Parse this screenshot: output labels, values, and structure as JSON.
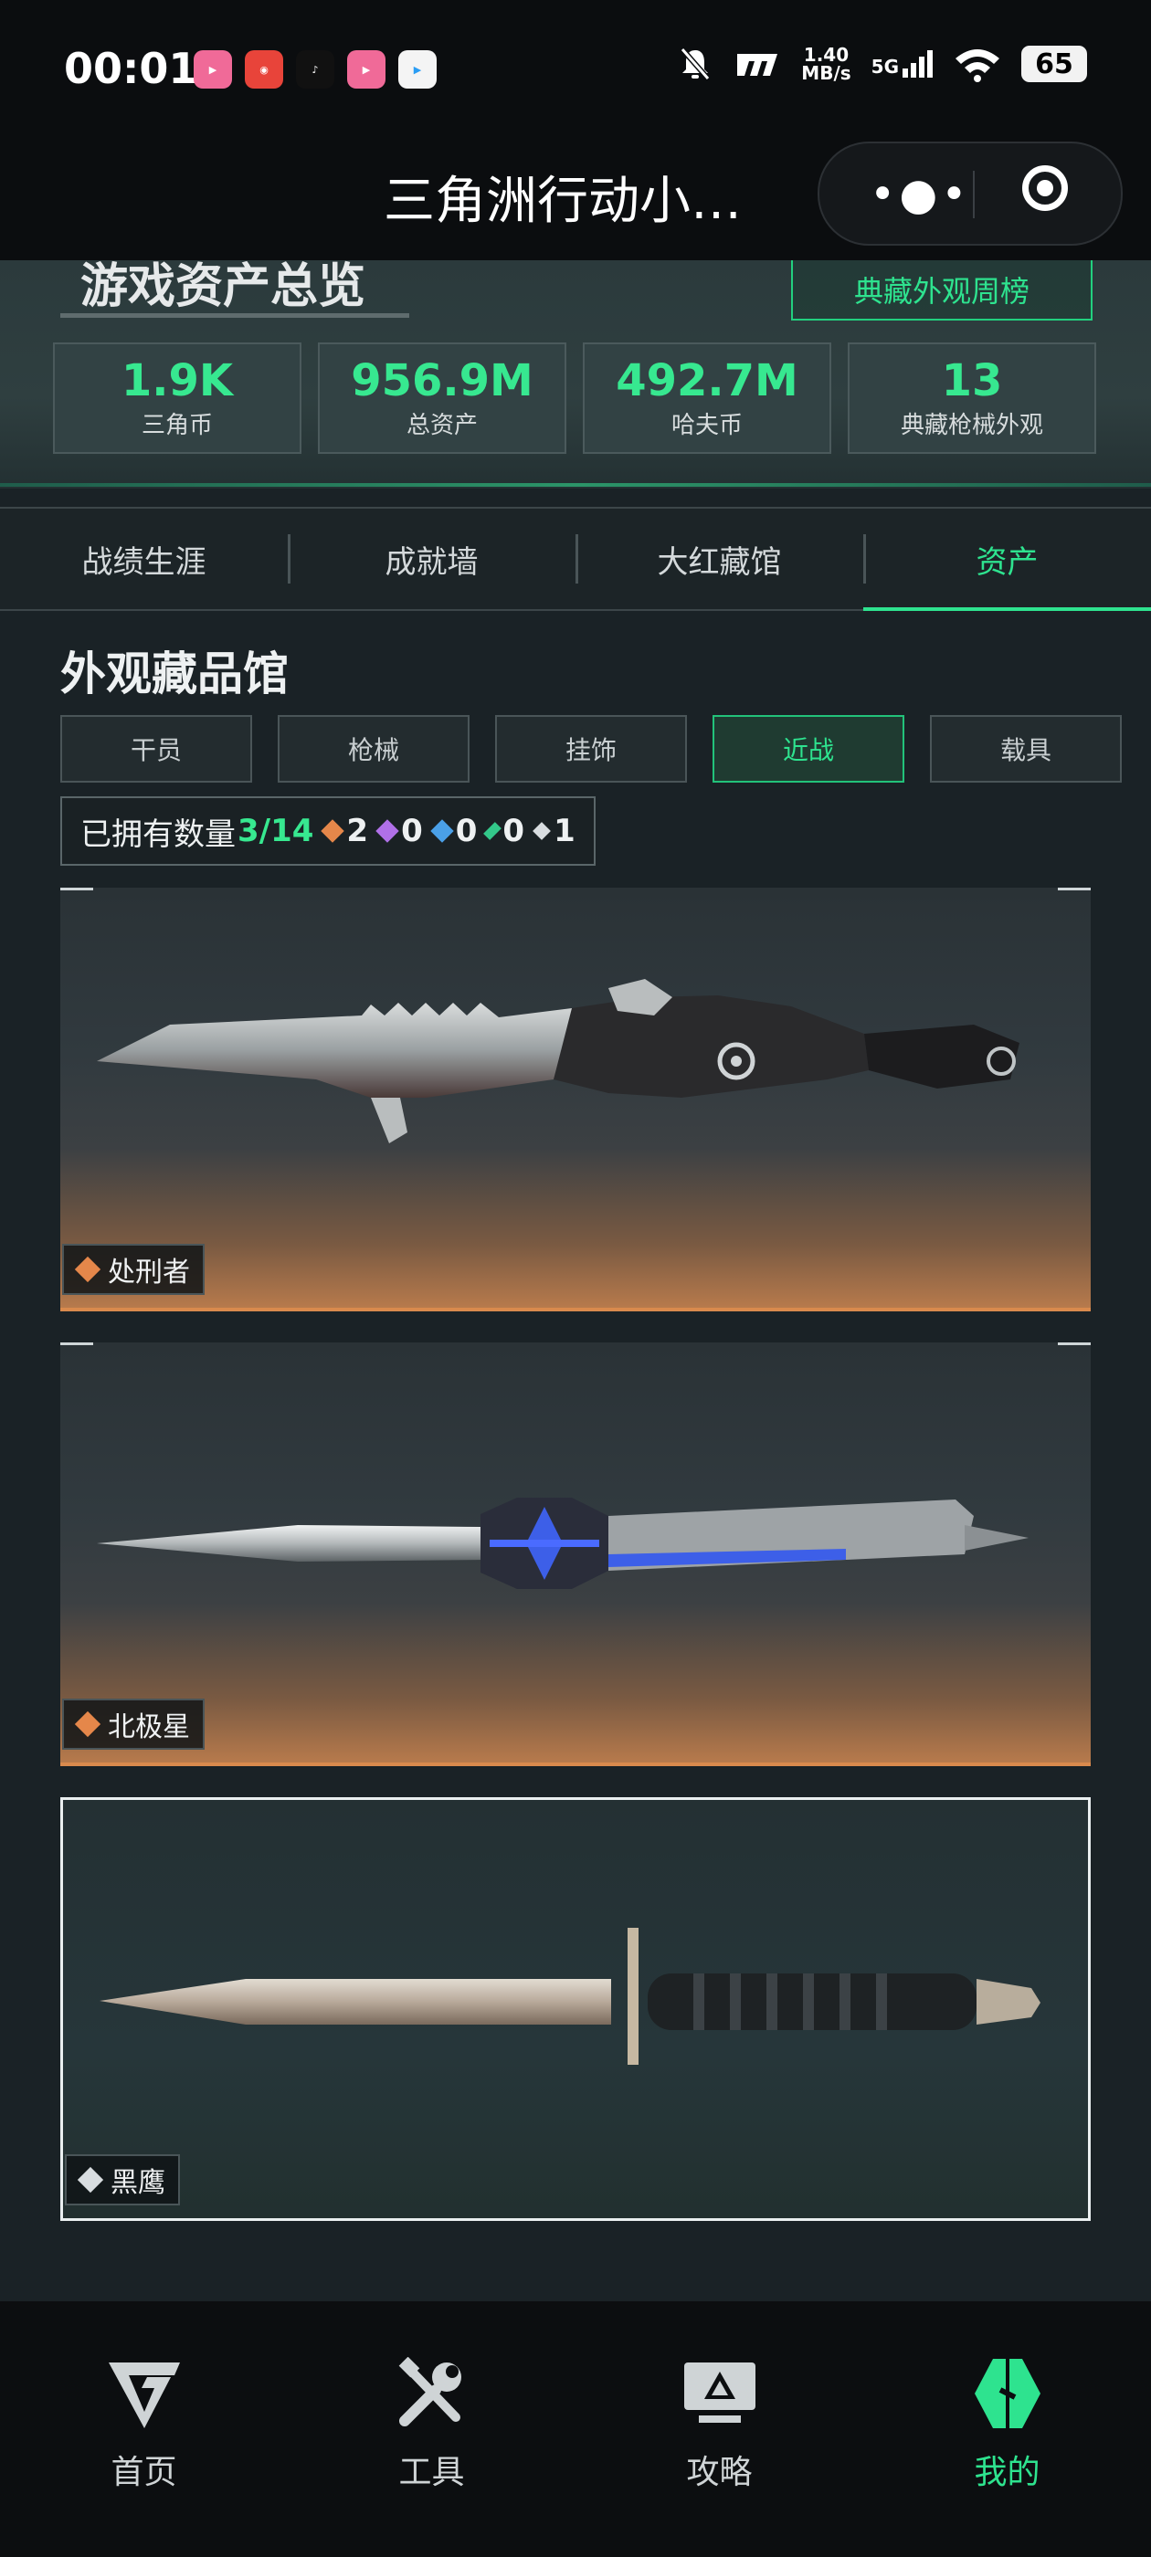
{
  "status_bar": {
    "time": "00:01",
    "net_speed_value": "1.40",
    "net_speed_unit": "MB/s",
    "network": "5G",
    "battery": "65",
    "apps": [
      "bilibili",
      "weibo",
      "tiktok",
      "bilibili",
      "play"
    ]
  },
  "titlebar": {
    "title": "三角洲行动小…"
  },
  "overview": {
    "title": "游戏资产总览",
    "rank_button": "典藏外观周榜",
    "stats": [
      {
        "value": "1.9K",
        "label": "三角币"
      },
      {
        "value": "956.9M",
        "label": "总资产"
      },
      {
        "value": "492.7M",
        "label": "哈夫币"
      },
      {
        "value": "13",
        "label": "典藏枪械外观"
      }
    ]
  },
  "tabs": [
    {
      "label": "战绩生涯",
      "active": false
    },
    {
      "label": "成就墙",
      "active": false
    },
    {
      "label": "大红藏馆",
      "active": false
    },
    {
      "label": "资产",
      "active": true
    }
  ],
  "collection": {
    "title": "外观藏品馆",
    "filters": [
      {
        "label": "干员",
        "active": false
      },
      {
        "label": "枪械",
        "active": false
      },
      {
        "label": "挂饰",
        "active": false
      },
      {
        "label": "近战",
        "active": true
      },
      {
        "label": "载具",
        "active": false
      }
    ],
    "owned_label": "已拥有数量",
    "owned_count": "3/14",
    "rarity_counts": [
      {
        "color": "#e5874a",
        "count": "2"
      },
      {
        "color": "#b070e8",
        "count": "0"
      },
      {
        "color": "#4aa0e8",
        "count": "0"
      },
      {
        "color": "#33c88a",
        "count": "0"
      },
      {
        "color": "#d8dde0",
        "count": "1"
      }
    ],
    "items": [
      {
        "name": "处刑者",
        "rarity": "orange"
      },
      {
        "name": "北极星",
        "rarity": "orange"
      },
      {
        "name": "黑鹰",
        "rarity": "white"
      }
    ]
  },
  "bottom_nav": [
    {
      "label": "首页",
      "icon": "home-logo-icon",
      "active": false
    },
    {
      "label": "工具",
      "icon": "tools-icon",
      "active": false
    },
    {
      "label": "攻略",
      "icon": "guide-monitor-icon",
      "active": false
    },
    {
      "label": "我的",
      "icon": "profile-logo-icon",
      "active": true
    }
  ],
  "colors": {
    "accent": "#2ee38f",
    "legendary": "#e5874a"
  }
}
